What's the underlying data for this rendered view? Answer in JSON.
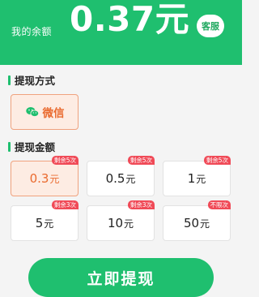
{
  "header": {
    "balance_label": "我的余额",
    "balance_amount": "0.37元",
    "service_label": "客服"
  },
  "method_section": {
    "title": "提现方式",
    "options": [
      {
        "label": "微信",
        "icon": "wechat-icon",
        "selected": true
      }
    ]
  },
  "amount_section": {
    "title": "提现金额",
    "options": [
      {
        "value": "0.3",
        "unit": "元",
        "badge": "剩余5次",
        "selected": true
      },
      {
        "value": "0.5",
        "unit": "元",
        "badge": "剩余5次",
        "selected": false
      },
      {
        "value": "1",
        "unit": "元",
        "badge": "剩余5次",
        "selected": false
      },
      {
        "value": "5",
        "unit": "元",
        "badge": "剩余3次",
        "selected": false
      },
      {
        "value": "10",
        "unit": "元",
        "badge": "剩余3次",
        "selected": false
      },
      {
        "value": "50",
        "unit": "元",
        "badge": "不限次",
        "selected": false
      }
    ]
  },
  "withdraw_button": {
    "label": "立即提现"
  },
  "colors": {
    "primary_green": "#1fbf6f",
    "selected_orange": "#ea6a2e",
    "badge_red": "#f04a57"
  }
}
